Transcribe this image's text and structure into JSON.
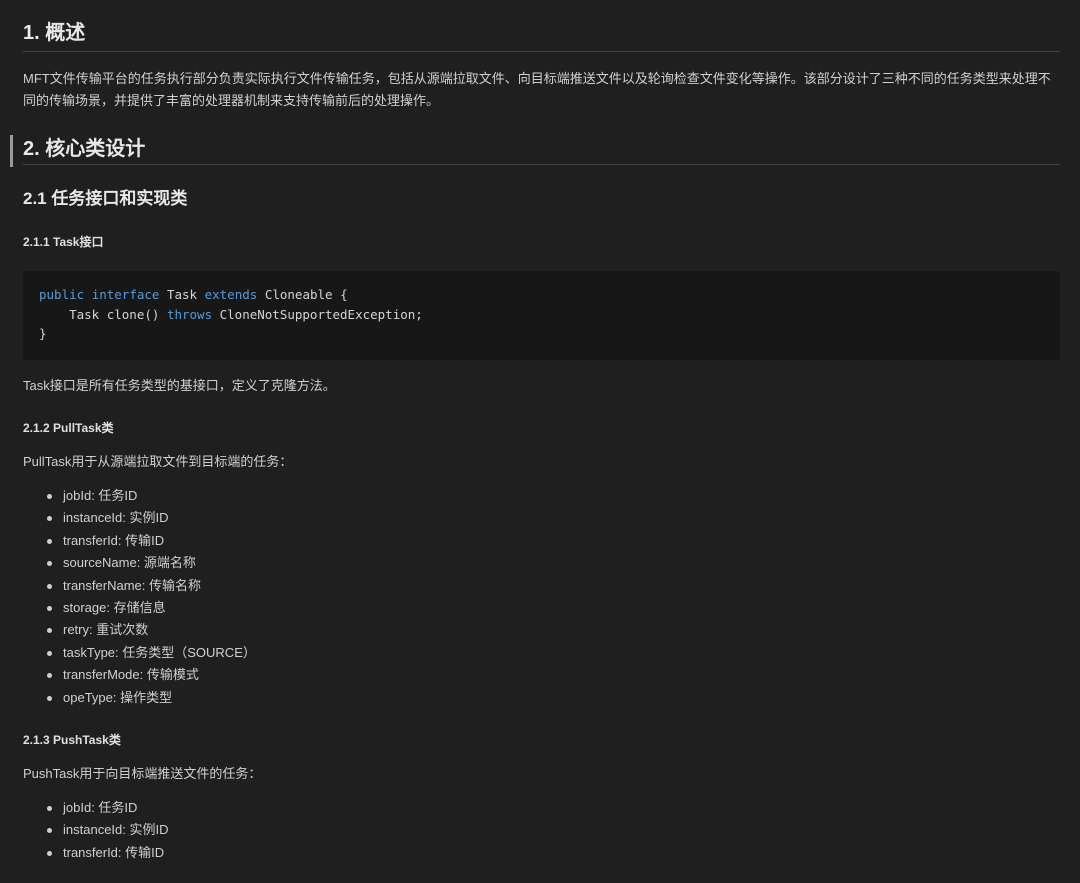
{
  "section1": {
    "heading": "1. 概述",
    "intro": "MFT文件传输平台的任务执行部分负责实际执行文件传输任务，包括从源端拉取文件、向目标端推送文件以及轮询检查文件变化等操作。该部分设计了三种不同的任务类型来处理不同的传输场景，并提供了丰富的处理器机制来支持传输前后的处理操作。"
  },
  "section2": {
    "heading": "2. 核心类设计",
    "sub1": {
      "heading": "2.1 任务接口和实现类",
      "task": {
        "heading": "2.1.1 Task接口",
        "code": {
          "line1_kw1": "public",
          "line1_kw2": "interface",
          "line1_name": "Task",
          "line1_kw3": "extends",
          "line1_rest": "Cloneable {",
          "line2_pre": "    Task clone() ",
          "line2_kw": "throws",
          "line2_rest": " CloneNotSupportedException;",
          "line3": "}"
        },
        "description": "Task接口是所有任务类型的基接口，定义了克隆方法。"
      },
      "pull_task": {
        "heading": "2.1.2 PullTask类",
        "description": "PullTask用于从源端拉取文件到目标端的任务：",
        "fields": [
          "jobId: 任务ID",
          "instanceId: 实例ID",
          "transferId: 传输ID",
          "sourceName: 源端名称",
          "transferName: 传输名称",
          "storage: 存储信息",
          "retry: 重试次数",
          "taskType: 任务类型（SOURCE）",
          "transferMode: 传输模式",
          "opeType: 操作类型"
        ]
      },
      "push_task": {
        "heading": "2.1.3 PushTask类",
        "description": "PushTask用于向目标端推送文件的任务：",
        "fields": [
          "jobId: 任务ID",
          "instanceId: 实例ID",
          "transferId: 传输ID"
        ]
      }
    }
  },
  "colors": {
    "background": "#1f1f1f",
    "code_background": "#171717",
    "keyword": "#569cd6",
    "text": "#d0d0d0"
  }
}
